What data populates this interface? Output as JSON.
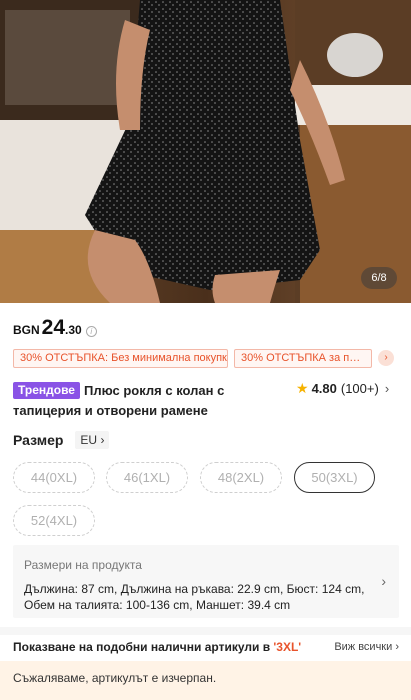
{
  "gallery": {
    "counter": "6/8"
  },
  "price": {
    "currency": "BGN",
    "integer": "24",
    "decimal": ".30"
  },
  "coupons": [
    {
      "label": "30% ОТСТЪПКА: Без минимална покупка"
    },
    {
      "label": "30% ОТСТЪПКА за поръ..."
    }
  ],
  "product": {
    "badge": "Трендове",
    "title": "Плюс рокля с колан с тапицерия и отворени рамене",
    "rating": "4.80",
    "review_count": "(100+)"
  },
  "size": {
    "label": "Размер",
    "region": "EU",
    "options": [
      {
        "label": "44(0XL)"
      },
      {
        "label": "46(1XL)"
      },
      {
        "label": "48(2XL)"
      },
      {
        "label": "50(3XL)"
      },
      {
        "label": "52(4XL)"
      }
    ],
    "selected": "50(3XL)"
  },
  "measurements": {
    "title": "Размери на продукта",
    "items": [
      {
        "key": "Дължина:",
        "value": "87 cm"
      },
      {
        "key": "Дължина на ръкава:",
        "value": "22.9 cm"
      },
      {
        "key": "Бюст:",
        "value": "124 cm"
      },
      {
        "key": "Обем на талията:",
        "value": "100-136 cm"
      },
      {
        "key": "Маншет:",
        "value": "39.4 cm"
      }
    ]
  },
  "similar": {
    "text": "Показване на подобни налични артикули в",
    "size_highlight": "'3XL'",
    "view_all": "Виж всички"
  },
  "soldout": {
    "message": "Съжаляваме, артикулът е изчерпан."
  },
  "colors": {
    "accent": "#e8532b",
    "trend_badge": "#8a53e6",
    "star": "#f6b200"
  }
}
